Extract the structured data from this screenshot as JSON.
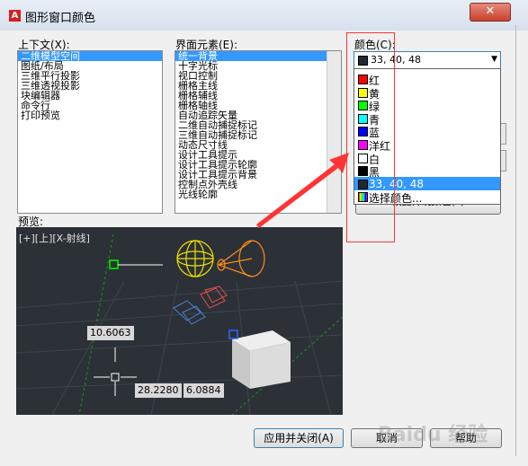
{
  "window": {
    "title": "图形窗口颜色",
    "app_icon_letter": "A",
    "close_glyph": "✕"
  },
  "context": {
    "label": "上下文(X):",
    "items": [
      "二维模型空间",
      "图纸/布局",
      "三维平行投影",
      "三维透视投影",
      "块编辑器",
      "命令行",
      "打印预览"
    ],
    "selected_index": 0
  },
  "interface": {
    "label": "界面元素(E):",
    "items": [
      "统一背景",
      "十字光标",
      "视口控制",
      "栅格主线",
      "栅格辅线",
      "栅格轴线",
      "自动追踪矢量",
      "二维自动捕捉标记",
      "三维自动捕捉标记",
      "动态尺寸线",
      "设计工具提示",
      "设计工具提示轮廓",
      "设计工具提示背景",
      "控制点外壳线",
      "光线轮廓"
    ],
    "selected_index": 0
  },
  "color": {
    "label": "颜色(C):",
    "current": {
      "name": "33, 40, 48",
      "swatch": "#212830"
    },
    "options": [
      {
        "name": "红",
        "swatch": "#ff0000"
      },
      {
        "name": "黄",
        "swatch": "#ffff00"
      },
      {
        "name": "绿",
        "swatch": "#00ff00"
      },
      {
        "name": "青",
        "swatch": "#00ffff"
      },
      {
        "name": "蓝",
        "swatch": "#0000ff"
      },
      {
        "name": "洋红",
        "swatch": "#ff00ff"
      },
      {
        "name": "白",
        "swatch": "#ffffff"
      },
      {
        "name": "黑",
        "swatch": "#000000"
      },
      {
        "name": "33, 40, 48",
        "swatch": "#212830"
      },
      {
        "name": "选择颜色...",
        "swatch": "rainbow"
      }
    ],
    "selected_option_index": 8,
    "partially_hidden_button": "恢复传统颜色(L)"
  },
  "preview": {
    "label": "预览:",
    "viewport_label": "[+][上][X-射线]",
    "dim_values": [
      "10.6063",
      "28.2280",
      "6.0884"
    ],
    "background": "#212830"
  },
  "buttons": {
    "apply": "应用并关闭(A)",
    "cancel": "取消",
    "help": "帮助"
  },
  "annotation": {
    "color": "#ff3333"
  },
  "watermark": {
    "text": "Baidu 经验"
  }
}
